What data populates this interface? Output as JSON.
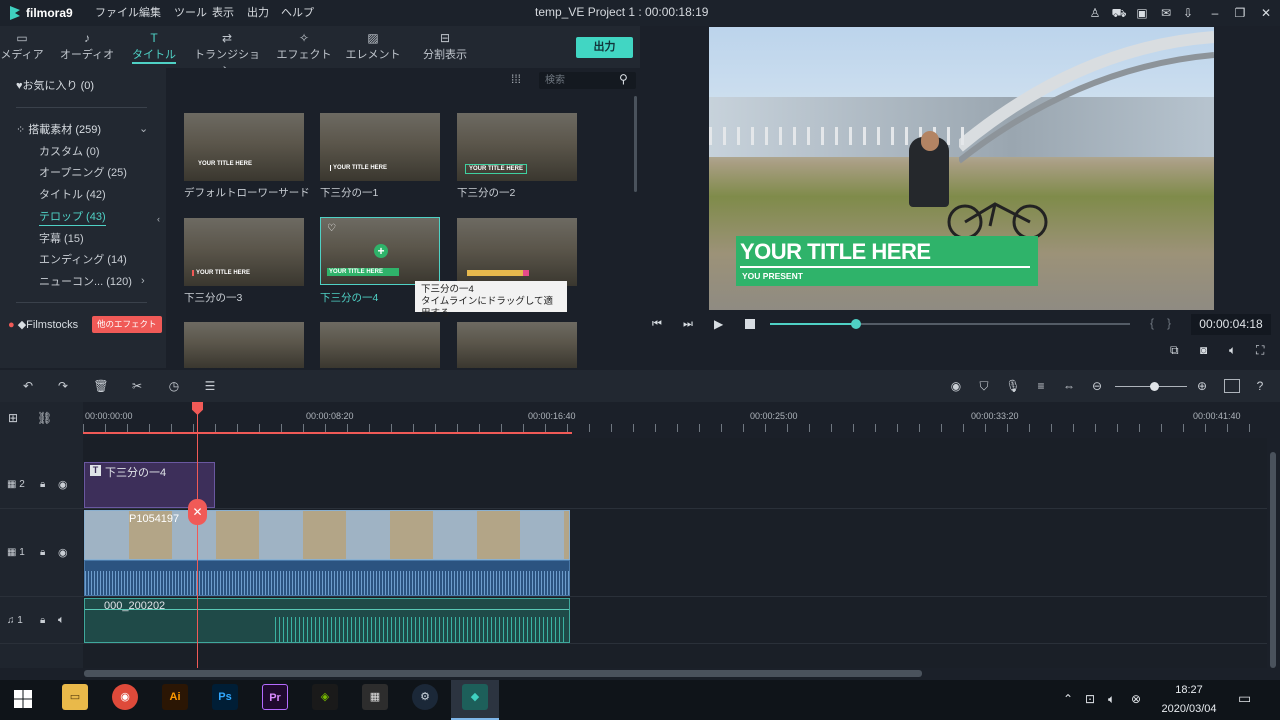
{
  "app": {
    "name": "filmora9",
    "project_title": "temp_VE Project 1 : 00:00:18:19"
  },
  "menu": [
    "ファイル",
    "編集",
    "ツール",
    "表示",
    "出力",
    "ヘルプ"
  ],
  "toolbar": {
    "tabs": [
      "メディア",
      "オーディオ",
      "タイトル",
      "トランジション",
      "エフェクト",
      "エレメント",
      "分割表示"
    ],
    "active_tab": "タイトル",
    "export_label": "出力"
  },
  "sidebar": {
    "favorites": "♥お気に入り (0)",
    "builtin": "搭載素材 (259)",
    "items": [
      "カスタム (0)",
      "オープニング (25)",
      "タイトル (42)",
      "テロップ (43)",
      "字幕 (15)",
      "エンディング (14)",
      "ニューコン... (120)"
    ],
    "active_item": "テロップ (43)",
    "filmstocks": "Filmstocks",
    "badge": "他のエフェクト"
  },
  "library": {
    "search_placeholder": "検索",
    "thumb_text": "YOUR TITLE HERE",
    "items": [
      "デフォルトローワーサード",
      "下三分の一1",
      "下三分の一2",
      "下三分の一3",
      "下三分の一4"
    ],
    "tooltip_title": "下三分の一4",
    "tooltip_desc": "タイムラインにドラッグして適用する"
  },
  "preview": {
    "title_text": "YOUR TITLE HERE",
    "subtitle_text": "YOU PRESENT",
    "timecode": "00:00:04:18",
    "progress": 0.24
  },
  "timeline": {
    "ruler": [
      "00:00:00:00",
      "00:00:08:20",
      "00:00:16:40",
      "00:00:25:00",
      "00:00:33:20",
      "00:00:41:40"
    ],
    "tracks": [
      {
        "label": "2",
        "clip": "下三分の一4"
      },
      {
        "label": "1",
        "clip": "P1054197"
      },
      {
        "label": "1",
        "clip": "000_200202"
      }
    ]
  },
  "taskbar": {
    "time": "18:27",
    "date": "2020/03/04"
  },
  "colors": {
    "accent": "#4fd1c5",
    "export": "#41d6c3",
    "playhead": "#f05a57",
    "title_bar": "#2fb36a"
  }
}
